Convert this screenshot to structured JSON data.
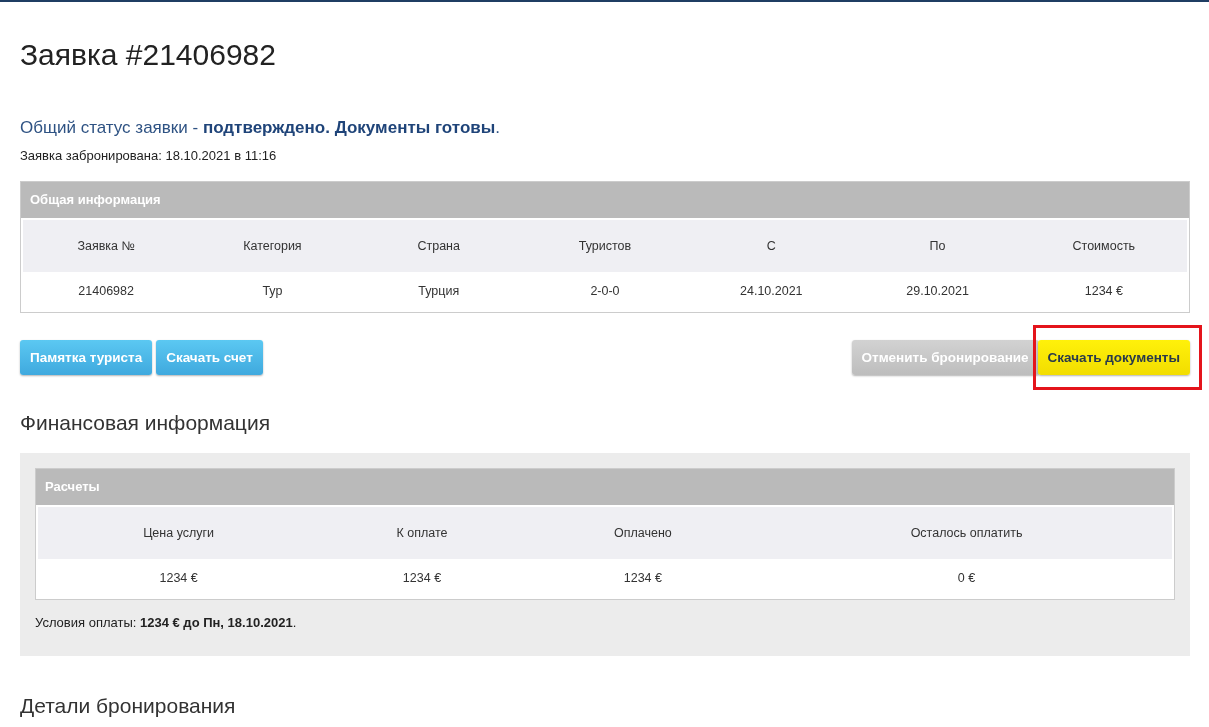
{
  "title": "Заявка #21406982",
  "status": "Общий статус заявки - **подтверждено. Документы готовы**.",
  "booked": "Заявка забронирована: 18.10.2021 в 11:16",
  "general": {
    "title": "Общая информация",
    "columns": [
      "Заявка №",
      "Категория",
      "Страна",
      "Туристов",
      "С",
      "По",
      "Стоимость"
    ],
    "rows": [
      [
        "21406982",
        "Тур",
        "Турция",
        "2-0-0",
        "24.10.2021",
        "29.10.2021",
        "1234 €"
      ]
    ]
  },
  "buttons_left": [
    {
      "label": "Памятка туриста",
      "kind": "info",
      "disabled": false,
      "highlighted": false
    },
    {
      "label": "Скачать счет",
      "kind": "info",
      "disabled": false,
      "highlighted": false
    }
  ],
  "buttons_right": [
    {
      "label": "Отменить бронирование",
      "kind": "default",
      "disabled": true,
      "highlighted": false
    },
    {
      "label": "Скачать документы",
      "kind": "warning",
      "disabled": false,
      "highlighted": true
    }
  ],
  "finance": {
    "heading": "Финансовая информация",
    "title": "Расчеты",
    "columns": [
      "Цена услуги",
      "К оплате",
      "Оплачено",
      "Осталось оплатить"
    ],
    "rows": [
      [
        "1234 €",
        "1234 €",
        "1234 €",
        "0 €"
      ]
    ],
    "conditions": "Условия оплаты: **1234 € до Пн, 18.10.2021**."
  },
  "details_heading": "Детали бронирования"
}
